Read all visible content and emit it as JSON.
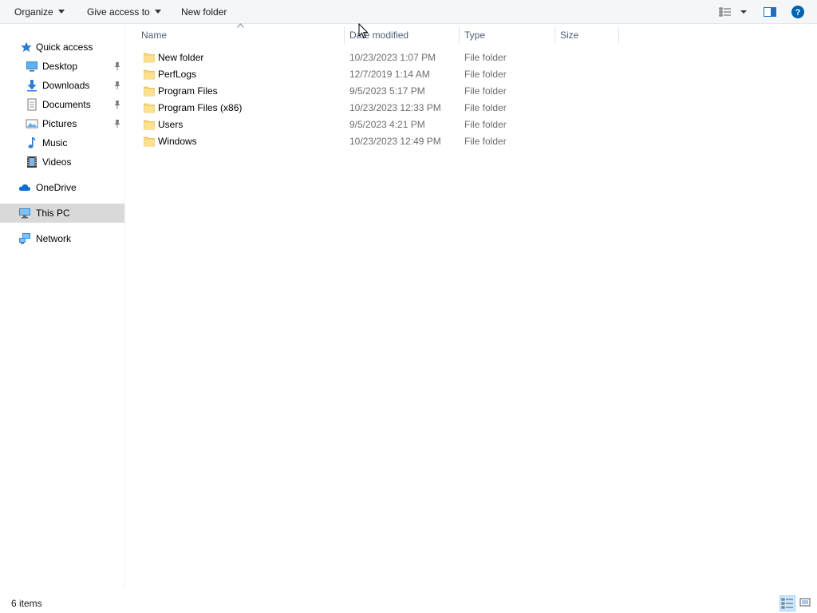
{
  "toolbar": {
    "organize_label": "Organize",
    "give_access_label": "Give access to",
    "new_folder_label": "New folder",
    "help_label": "?"
  },
  "nav": {
    "quick_access": "Quick access",
    "items": [
      {
        "label": "Desktop",
        "icon": "desktop-icon",
        "pinned": true
      },
      {
        "label": "Downloads",
        "icon": "downloads-icon",
        "pinned": true
      },
      {
        "label": "Documents",
        "icon": "documents-icon",
        "pinned": true
      },
      {
        "label": "Pictures",
        "icon": "pictures-icon",
        "pinned": true
      },
      {
        "label": "Music",
        "icon": "music-icon",
        "pinned": false
      },
      {
        "label": "Videos",
        "icon": "videos-icon",
        "pinned": false
      }
    ],
    "onedrive": "OneDrive",
    "this_pc": "This PC",
    "network": "Network"
  },
  "columns": {
    "name": "Name",
    "date_modified": "Date modified",
    "type": "Type",
    "size": "Size"
  },
  "files": [
    {
      "name": "New folder",
      "date": "10/23/2023 1:07 PM",
      "type": "File folder"
    },
    {
      "name": "PerfLogs",
      "date": "12/7/2019 1:14 AM",
      "type": "File folder"
    },
    {
      "name": "Program Files",
      "date": "9/5/2023 5:17 PM",
      "type": "File folder"
    },
    {
      "name": "Program Files (x86)",
      "date": "10/23/2023 12:33 PM",
      "type": "File folder"
    },
    {
      "name": "Users",
      "date": "9/5/2023 4:21 PM",
      "type": "File folder"
    },
    {
      "name": "Windows",
      "date": "10/23/2023 12:49 PM",
      "type": "File folder"
    }
  ],
  "status": {
    "item_count": "6 items"
  },
  "colors": {
    "folder": "#f8d775",
    "selection": "#d9d9d9",
    "header_text": "#4c607a",
    "accent": "#0063b1"
  }
}
